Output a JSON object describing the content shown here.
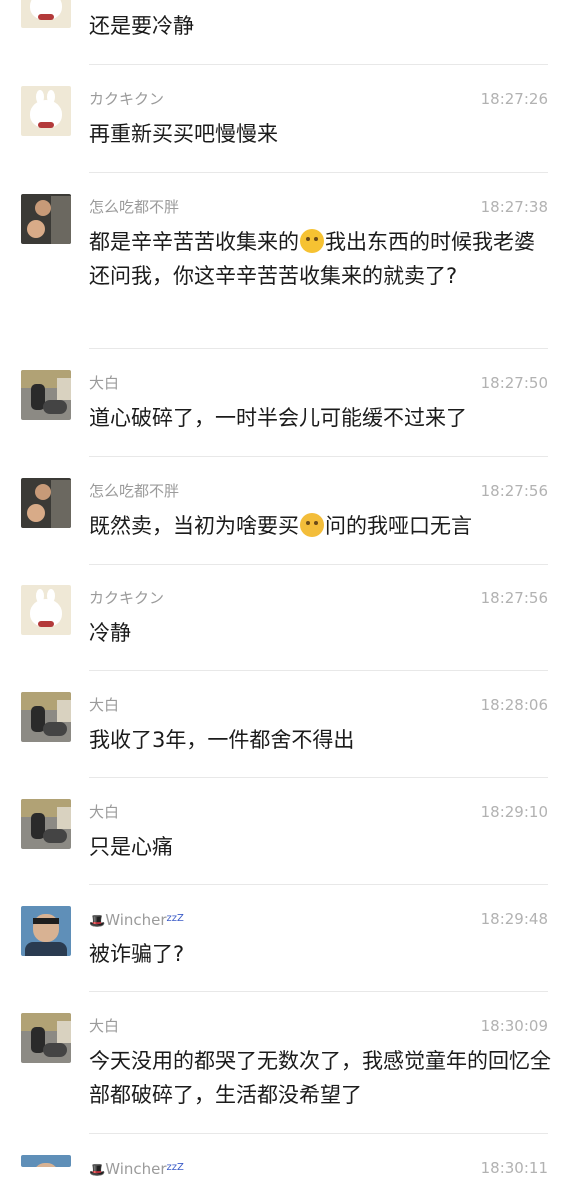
{
  "messages": [
    {
      "name": "",
      "time": "",
      "text": "还是要冷静"
    },
    {
      "name": "カクキクン",
      "time": "18:27:26",
      "text": "再重新买买吧慢慢来"
    },
    {
      "name": "怎么吃都不胖",
      "time": "18:27:38",
      "text_a": "都是辛辛苦苦收集来的",
      "text_b": "我出东西的时候我老婆还问我，你这辛辛苦苦收集来的就卖了?",
      "emoji": "dizzy-face-emoji"
    },
    {
      "name": "大白",
      "time": "18:27:50",
      "text": "道心破碎了，一时半会儿可能缓不过来了"
    },
    {
      "name": "怎么吃都不胖",
      "time": "18:27:56",
      "text_a": "既然卖，当初为啥要买",
      "text_b": "问的我哑口无言",
      "emoji": "crying-face-emoji"
    },
    {
      "name": "カクキクン",
      "time": "18:27:56",
      "text": "冷静"
    },
    {
      "name": "大白",
      "time": "18:28:06",
      "text": "我收了3年，一件都舍不得出"
    },
    {
      "name": "大白",
      "time": "18:29:10",
      "text": "只是心痛"
    },
    {
      "name": "Wincher",
      "name_suffix": "zzZ",
      "time": "18:29:48",
      "text": "被诈骗了?"
    },
    {
      "name": "大白",
      "time": "18:30:09",
      "text": "今天没用的都哭了无数次了，我感觉童年的回忆全部都破碎了，生活都没希望了"
    },
    {
      "name": "Wincher",
      "name_suffix": "zzZ",
      "time": "18:30:11",
      "text": ""
    }
  ]
}
